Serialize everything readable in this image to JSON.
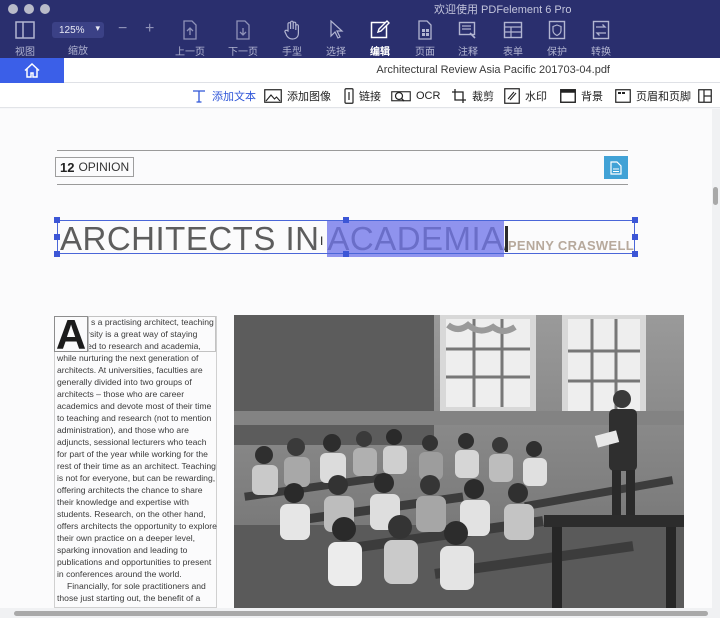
{
  "window": {
    "title": "欢迎使用 PDFelement 6 Pro"
  },
  "toolbar": {
    "view": "视图",
    "zoom_value": "125%",
    "zoom_label": "缩放",
    "prev_page": "上一页",
    "next_page": "下一页",
    "hand": "手型",
    "select": "选择",
    "edit": "编辑",
    "page": "页面",
    "comment": "注释",
    "form": "表单",
    "protect": "保护",
    "convert": "转换"
  },
  "tabbar": {
    "filename": "Architectural Review Asia Pacific 201703-04.pdf"
  },
  "ribbon": {
    "add_text": "添加文本",
    "add_image": "添加图像",
    "link": "链接",
    "ocr": "OCR",
    "crop": "裁剪",
    "watermark": "水印",
    "background": "背景",
    "header_footer": "页眉和页脚"
  },
  "document": {
    "section_number": "12",
    "section_name": "OPINION",
    "headline_plain": "ARCHITECTS IN ",
    "headline_selected": "ACADEMIA",
    "byline": "PENNY CRASWELL",
    "drop_cap": "A",
    "body_paragraph_1": "s a practising architect, teaching at university is a great way of staying connected to research and academia, while nurturing the next generation of architects. At universities, faculties are generally divided into two groups of architects – those who are career academics and devote most of their time to teaching and research (not to mention administration), and those who are adjuncts, sessional lecturers who teach for part of the year while working for the rest of their time as an architect. Teaching is not for everyone, but can be rewarding, offering architects the chance to share their knowledge and expertise with students. Research, on the other hand, offers architects the opportunity to explore their own practice on a deeper level, sparking innovation and leading to publications and opportunities to present in conferences around the world.",
    "body_paragraph_2": "Financially, for sole practitioners and those just starting out, the benefit of a"
  },
  "colors": {
    "toolbar_bg": "#2a2f6e",
    "accent_blue": "#3b5fe8",
    "selection_highlight": "#8f93ee",
    "byline_color": "#b7a99c",
    "badge_blue": "#41a2d6"
  }
}
